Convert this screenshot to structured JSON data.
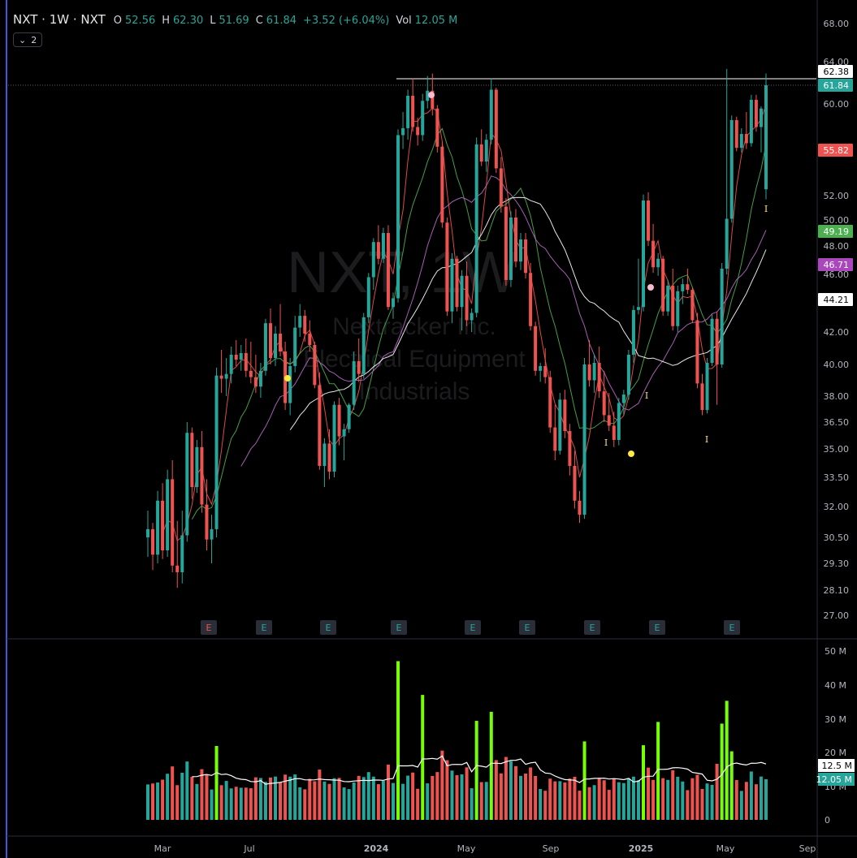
{
  "header": {
    "symbol_line": "NXT · 1W · NXT",
    "o_label": "O",
    "o_value": "52.56",
    "h_label": "H",
    "h_value": "62.30",
    "l_label": "L",
    "l_value": "51.69",
    "c_label": "C",
    "c_value": "61.84",
    "change": "+3.52 (+6.04%)",
    "vol_label": "Vol",
    "vol_value": "12.05 M"
  },
  "indicator_badge": {
    "count": "2"
  },
  "watermark": {
    "ticker": "NXT, 1W",
    "company": "Nextracker Inc.",
    "sector": "Electrical Equipment",
    "industry": "Industrials"
  },
  "colors": {
    "up": "#26a69a",
    "down": "#ef5350",
    "bg": "#000000",
    "ma_red": "#ef5350",
    "ma_green": "#4caf50",
    "ma_purple": "#ba68c8",
    "ma_white": "#ffffff",
    "vol_bright": "#76ff03",
    "vol_orange": "#ff9800"
  },
  "chart_data": {
    "type": "candlestick",
    "timeframe": "1W",
    "price_axis_ticks": [
      "68.00",
      "64.00",
      "60.00",
      "56.00",
      "52.00",
      "50.00",
      "48.00",
      "46.00",
      "44.00",
      "42.00",
      "40.00",
      "38.00",
      "36.50",
      "35.00",
      "33.50",
      "32.00",
      "30.50",
      "29.30",
      "28.10",
      "27.00"
    ],
    "price_labels": [
      {
        "text": "62.38",
        "style": "white"
      },
      {
        "text": "61.84",
        "style": "up"
      },
      {
        "text": "55.82",
        "style": "down"
      },
      {
        "text": "49.19",
        "style": "green"
      },
      {
        "text": "46.71",
        "style": "purple"
      },
      {
        "text": "44.21",
        "style": "white"
      }
    ],
    "resistance_level": 62.38,
    "time_axis": [
      "Mar",
      "Jul",
      "2024",
      "May",
      "Sep",
      "2025",
      "May",
      "Sep"
    ],
    "earnings_markers": [
      "E",
      "E",
      "E",
      "E",
      "E",
      "E",
      "E",
      "E",
      "E"
    ],
    "volume_axis_ticks": [
      "50 M",
      "40 M",
      "30 M",
      "20 M",
      "10 M",
      "0"
    ],
    "volume_labels": [
      {
        "text": "12.5 M",
        "style": "white"
      },
      {
        "text": "12.05 M",
        "style": "up"
      }
    ],
    "signal_marks": [
      "I",
      "I",
      "I",
      "I"
    ],
    "candles": [
      [
        30.5,
        31.8,
        29.6,
        30.9
      ],
      [
        30.9,
        31.2,
        29.0,
        29.7
      ],
      [
        29.7,
        32.8,
        29.3,
        32.3
      ],
      [
        32.3,
        33.2,
        29.5,
        29.9
      ],
      [
        29.9,
        33.9,
        29.6,
        33.4
      ],
      [
        33.4,
        34.4,
        28.9,
        29.2
      ],
      [
        29.2,
        31.3,
        28.2,
        28.9
      ],
      [
        28.9,
        31.8,
        28.4,
        30.6
      ],
      [
        30.6,
        36.5,
        30.3,
        35.9
      ],
      [
        35.9,
        36.2,
        32.4,
        33.0
      ],
      [
        33.0,
        35.5,
        32.7,
        35.1
      ],
      [
        35.1,
        36.0,
        31.7,
        32.1
      ],
      [
        32.1,
        33.4,
        29.9,
        30.4
      ],
      [
        30.4,
        31.6,
        29.3,
        30.9
      ],
      [
        30.9,
        39.8,
        30.5,
        39.3
      ],
      [
        39.3,
        40.9,
        38.2,
        39.1
      ],
      [
        39.1,
        40.4,
        38.0,
        39.4
      ],
      [
        39.4,
        41.1,
        38.8,
        40.6
      ],
      [
        40.6,
        41.5,
        39.9,
        40.3
      ],
      [
        40.3,
        41.2,
        39.6,
        40.7
      ],
      [
        40.7,
        41.6,
        39.2,
        39.6
      ],
      [
        39.6,
        41.4,
        38.8,
        39.2
      ],
      [
        39.2,
        40.6,
        38.2,
        38.6
      ],
      [
        38.6,
        40.1,
        37.9,
        39.6
      ],
      [
        39.6,
        42.9,
        39.3,
        42.6
      ],
      [
        42.6,
        43.6,
        40.0,
        40.4
      ],
      [
        40.4,
        42.4,
        39.9,
        41.9
      ],
      [
        41.9,
        43.9,
        40.5,
        40.8
      ],
      [
        40.8,
        41.4,
        37.2,
        37.6
      ],
      [
        37.6,
        40.4,
        36.9,
        39.9
      ],
      [
        39.9,
        43.1,
        39.5,
        42.3
      ],
      [
        42.3,
        43.9,
        41.7,
        43.1
      ],
      [
        43.1,
        43.5,
        41.4,
        41.9
      ],
      [
        41.9,
        42.8,
        40.8,
        41.2
      ],
      [
        41.2,
        41.4,
        38.5,
        38.7
      ],
      [
        38.7,
        39.5,
        33.9,
        34.1
      ],
      [
        34.1,
        35.6,
        33.0,
        35.3
      ],
      [
        35.3,
        36.1,
        33.4,
        33.8
      ],
      [
        33.8,
        37.7,
        33.5,
        37.5
      ],
      [
        37.5,
        37.9,
        35.2,
        35.7
      ],
      [
        35.7,
        36.4,
        34.4,
        36.1
      ],
      [
        36.1,
        37.6,
        35.9,
        37.5
      ],
      [
        37.5,
        40.8,
        37.2,
        40.2
      ],
      [
        40.2,
        41.6,
        38.9,
        39.4
      ],
      [
        39.4,
        43.3,
        39.1,
        43.0
      ],
      [
        43.0,
        46.1,
        42.6,
        45.8
      ],
      [
        45.8,
        48.6,
        44.9,
        48.3
      ],
      [
        48.3,
        49.6,
        46.7,
        47.1
      ],
      [
        47.1,
        49.4,
        46.8,
        49.0
      ],
      [
        49.0,
        49.6,
        43.5,
        43.7
      ],
      [
        43.7,
        44.7,
        42.9,
        44.3
      ],
      [
        44.3,
        57.8,
        44.0,
        57.3
      ],
      [
        57.3,
        59.3,
        56.1,
        57.9
      ],
      [
        57.9,
        61.4,
        56.9,
        60.8
      ],
      [
        60.8,
        62.1,
        57.6,
        58.0
      ],
      [
        58.0,
        58.8,
        56.4,
        57.3
      ],
      [
        57.3,
        61.0,
        56.8,
        60.3
      ],
      [
        60.3,
        62.2,
        59.6,
        61.3
      ],
      [
        61.3,
        62.3,
        59.0,
        59.6
      ],
      [
        59.6,
        59.9,
        55.8,
        56.3
      ],
      [
        56.3,
        56.7,
        49.4,
        49.8
      ],
      [
        49.8,
        50.2,
        43.1,
        43.4
      ],
      [
        43.4,
        47.5,
        42.6,
        47.1
      ],
      [
        47.1,
        47.3,
        43.4,
        43.7
      ],
      [
        43.7,
        46.3,
        42.1,
        45.9
      ],
      [
        45.9,
        46.9,
        42.4,
        42.8
      ],
      [
        42.8,
        43.6,
        42.0,
        43.3
      ],
      [
        43.3,
        57.1,
        43.0,
        56.5
      ],
      [
        56.5,
        57.8,
        54.6,
        55.0
      ],
      [
        55.0,
        57.4,
        54.1,
        56.9
      ],
      [
        56.9,
        62.1,
        56.5,
        61.4
      ],
      [
        61.4,
        61.6,
        54.0,
        54.4
      ],
      [
        54.4,
        55.4,
        50.6,
        51.1
      ],
      [
        51.1,
        51.8,
        45.2,
        45.6
      ],
      [
        45.6,
        50.7,
        45.1,
        50.2
      ],
      [
        50.2,
        50.9,
        46.5,
        46.9
      ],
      [
        46.9,
        49.0,
        46.3,
        48.5
      ],
      [
        48.5,
        49.0,
        45.7,
        46.1
      ],
      [
        46.1,
        46.8,
        42.1,
        42.4
      ],
      [
        42.4,
        42.7,
        39.3,
        39.6
      ],
      [
        39.6,
        40.1,
        38.9,
        39.9
      ],
      [
        39.9,
        41.0,
        38.8,
        39.2
      ],
      [
        39.2,
        39.6,
        35.9,
        36.2
      ],
      [
        36.2,
        37.5,
        34.4,
        34.9
      ],
      [
        34.9,
        38.2,
        34.7,
        37.8
      ],
      [
        37.8,
        38.4,
        35.6,
        36.0
      ],
      [
        36.0,
        36.4,
        33.6,
        34.1
      ],
      [
        34.1,
        34.9,
        31.9,
        32.3
      ],
      [
        32.3,
        32.8,
        31.2,
        31.6
      ],
      [
        31.6,
        40.4,
        31.4,
        40.0
      ],
      [
        40.0,
        41.5,
        38.6,
        39.0
      ],
      [
        39.0,
        40.6,
        38.2,
        40.1
      ],
      [
        40.1,
        41.1,
        37.9,
        38.3
      ],
      [
        38.3,
        39.6,
        36.5,
        36.9
      ],
      [
        36.9,
        38.2,
        36.0,
        36.3
      ],
      [
        36.3,
        37.1,
        35.1,
        35.5
      ],
      [
        35.5,
        37.9,
        35.2,
        37.6
      ],
      [
        37.6,
        38.4,
        36.9,
        38.1
      ],
      [
        38.1,
        40.9,
        37.8,
        40.6
      ],
      [
        40.6,
        43.8,
        40.1,
        43.5
      ],
      [
        43.5,
        47.1,
        43.2,
        43.7
      ],
      [
        43.7,
        52.1,
        43.4,
        51.6
      ],
      [
        51.6,
        52.3,
        48.0,
        48.4
      ],
      [
        48.4,
        49.7,
        46.1,
        46.5
      ],
      [
        46.5,
        47.5,
        45.9,
        47.1
      ],
      [
        47.1,
        47.3,
        43.1,
        43.4
      ],
      [
        43.4,
        45.6,
        43.1,
        45.2
      ],
      [
        45.2,
        46.4,
        42.1,
        42.4
      ],
      [
        42.4,
        45.2,
        42.0,
        44.8
      ],
      [
        44.8,
        45.7,
        43.9,
        45.3
      ],
      [
        45.3,
        46.4,
        44.6,
        44.9
      ],
      [
        44.9,
        45.1,
        42.6,
        42.8
      ],
      [
        42.8,
        43.3,
        38.5,
        38.8
      ],
      [
        38.8,
        39.4,
        36.9,
        37.2
      ],
      [
        37.2,
        40.4,
        37.0,
        40.1
      ],
      [
        40.1,
        43.2,
        39.9,
        42.9
      ],
      [
        42.9,
        43.4,
        37.5,
        40.0
      ],
      [
        40.0,
        46.8,
        39.8,
        46.4
      ],
      [
        46.4,
        62.8,
        46.0,
        50.1
      ],
      [
        50.1,
        59.0,
        49.8,
        58.6
      ],
      [
        58.6,
        58.9,
        55.9,
        56.2
      ],
      [
        56.2,
        57.9,
        55.8,
        57.4
      ],
      [
        57.4,
        59.3,
        56.1,
        56.6
      ],
      [
        56.6,
        60.9,
        56.3,
        60.4
      ],
      [
        60.4,
        60.9,
        57.6,
        58.0
      ],
      [
        58.0,
        59.8,
        55.8,
        59.6
      ],
      [
        52.56,
        62.3,
        51.69,
        61.84
      ]
    ]
  }
}
